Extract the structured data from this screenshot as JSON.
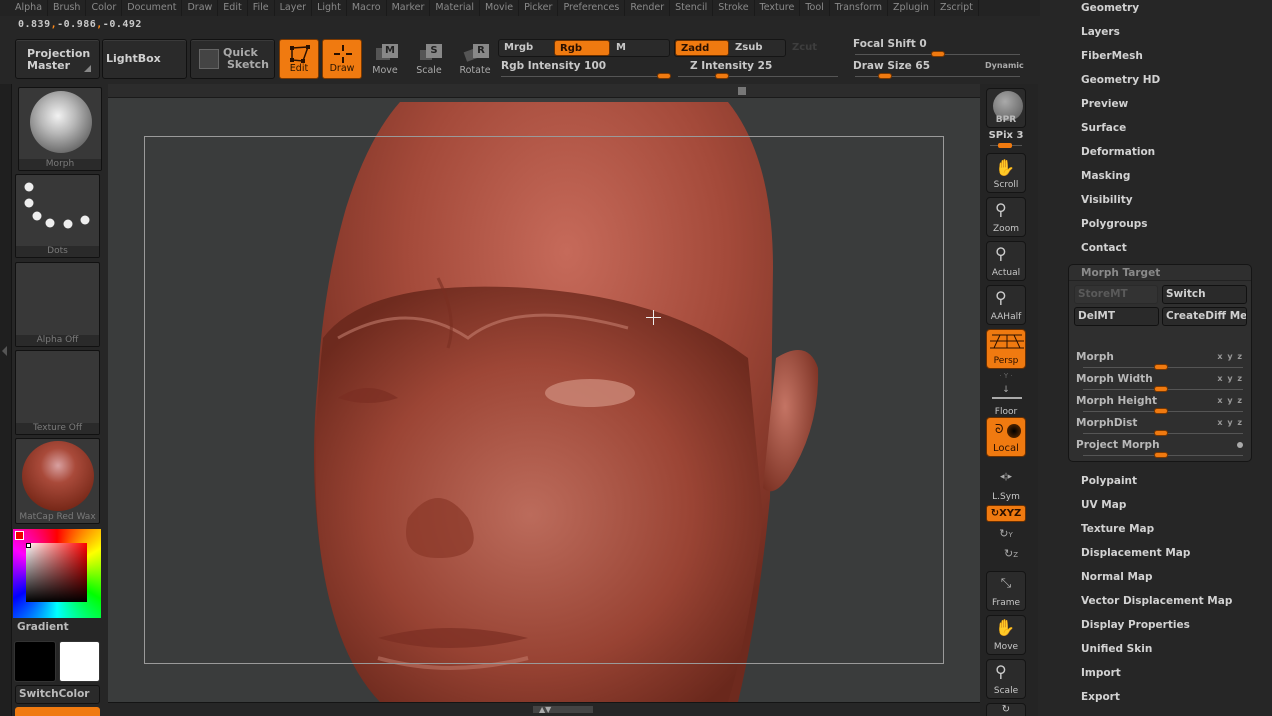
{
  "menu": [
    "Alpha",
    "Brush",
    "Color",
    "Document",
    "Draw",
    "Edit",
    "File",
    "Layer",
    "Light",
    "Macro",
    "Marker",
    "Material",
    "Movie",
    "Picker",
    "Preferences",
    "Render",
    "Stencil",
    "Stroke",
    "Texture",
    "Tool",
    "Transform",
    "Zplugin",
    "Zscript"
  ],
  "coords": {
    "x": "0.839",
    "y": "-0.986",
    "z": "-0.492"
  },
  "shelf": {
    "projection_master": {
      "line1": "Projection",
      "line2": "Master"
    },
    "lightbox": "LightBox",
    "quick_sketch": {
      "line1": "Quick",
      "line2": "Sketch"
    },
    "edit": "Edit",
    "draw": "Draw",
    "move": "Move",
    "scale": "Scale",
    "rotate": "Rotate",
    "mrgb": "Mrgb",
    "rgb": "Rgb",
    "m": "M",
    "zadd": "Zadd",
    "zsub": "Zsub",
    "zcut": "Zcut",
    "rgb_intensity": {
      "label": "Rgb Intensity",
      "value": 100,
      "fraction": 1.0
    },
    "z_intensity": {
      "label": "Z Intensity",
      "value": 25,
      "fraction": 0.25
    },
    "focal_shift": {
      "label": "Focal Shift",
      "value": 0,
      "fraction": 0.5
    },
    "draw_size": {
      "label": "Draw Size",
      "value": 65,
      "fraction": 0.15
    },
    "dynamic": "Dynamic"
  },
  "left_tray": {
    "brush": "Morph",
    "stroke": "Dots",
    "alpha": "Alpha Off",
    "texture": "Texture Off",
    "material": "MatCap Red Wax",
    "gradient": "Gradient",
    "switch_color": "SwitchColor",
    "primary_color": "#000000",
    "secondary_color": "#ffffff"
  },
  "right_tools": {
    "bpr": "BPR",
    "spix": {
      "label": "SPix",
      "value": 3
    },
    "scroll": "Scroll",
    "zoom": "Zoom",
    "actual": "Actual",
    "aahalf": "AAHalf",
    "persp": "Persp",
    "floor": "Floor",
    "local": "Local",
    "lsym": "L.Sym",
    "xyz": "XYZ",
    "y": "Y",
    "z": "Z",
    "frame": "Frame",
    "move": "Move",
    "scale": "Scale"
  },
  "palette": {
    "items_top": [
      "Geometry",
      "Layers",
      "FiberMesh",
      "Geometry HD",
      "Preview",
      "Surface",
      "Deformation",
      "Masking",
      "Visibility",
      "Polygroups",
      "Contact"
    ],
    "morph_target": {
      "title": "Morph Target",
      "store": "StoreMT",
      "switch": "Switch",
      "del": "DelMT",
      "create_diff": "CreateDiff Mesh",
      "sliders": [
        {
          "label": "Morph",
          "xyz": "x y z",
          "fraction": 0.5
        },
        {
          "label": "Morph Width",
          "xyz": "x y z",
          "fraction": 0.5
        },
        {
          "label": "Morph Height",
          "xyz": "x y z",
          "fraction": 0.5
        },
        {
          "label": "MorphDist",
          "xyz": "x y z",
          "fraction": 0.5
        },
        {
          "label": "Project Morph",
          "xyz": "",
          "fraction": 0.5
        }
      ]
    },
    "items_bottom": [
      "Polypaint",
      "UV Map",
      "Texture Map",
      "Displacement Map",
      "Normal Map",
      "Vector Displacement Map",
      "Display Properties",
      "Unified Skin",
      "Import",
      "Export"
    ]
  },
  "colors": {
    "accent": "#f07a10",
    "clay": "#a8473a"
  }
}
